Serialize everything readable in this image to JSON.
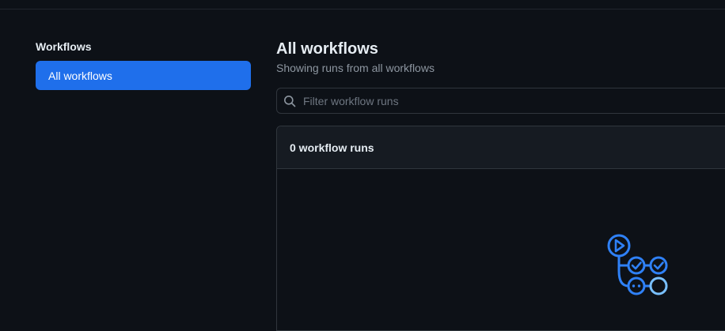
{
  "sidebar": {
    "heading": "Workflows",
    "items": [
      {
        "label": "All workflows",
        "selected": true
      }
    ]
  },
  "main": {
    "title": "All workflows",
    "subtitle": "Showing runs from all workflows",
    "search": {
      "placeholder": "Filter workflow runs",
      "value": ""
    },
    "runs": {
      "count_label": "0 workflow runs",
      "empty_state_icon": "actions-workflow-icon"
    }
  },
  "colors": {
    "background": "#0d1117",
    "accent": "#1f6feb",
    "border": "#30363d",
    "icon_blue": "#2f81f7",
    "icon_light": "#79c0ff"
  }
}
